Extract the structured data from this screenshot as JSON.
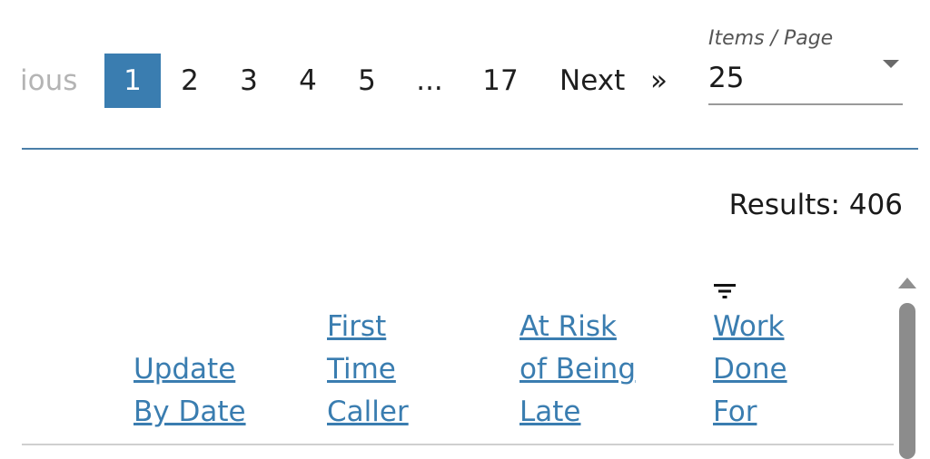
{
  "pagination": {
    "prev_label": "ious",
    "pages": [
      "1",
      "2",
      "3",
      "4",
      "5",
      "...",
      "17"
    ],
    "active_page": "1",
    "next_label": "Next",
    "next_arrow": "»"
  },
  "items_per_page": {
    "label": "Items / Page",
    "value": "25"
  },
  "results": {
    "text": "Results: 406"
  },
  "columns": [
    {
      "lines": [
        "Update",
        "By Date"
      ]
    },
    {
      "lines": [
        "First",
        "Time",
        "Caller"
      ]
    },
    {
      "lines": [
        "At Risk",
        "of Being",
        "Late"
      ]
    },
    {
      "lines": [
        "Work",
        "Done",
        "For"
      ]
    }
  ],
  "icons": {
    "filter": "filter-icon",
    "dropdown": "chevron-down-icon",
    "scroll_up": "scroll-up-icon"
  },
  "colors": {
    "accent": "#3a7db0",
    "divider": "#4a7fa8",
    "disabled_text": "#b4b4b4"
  }
}
